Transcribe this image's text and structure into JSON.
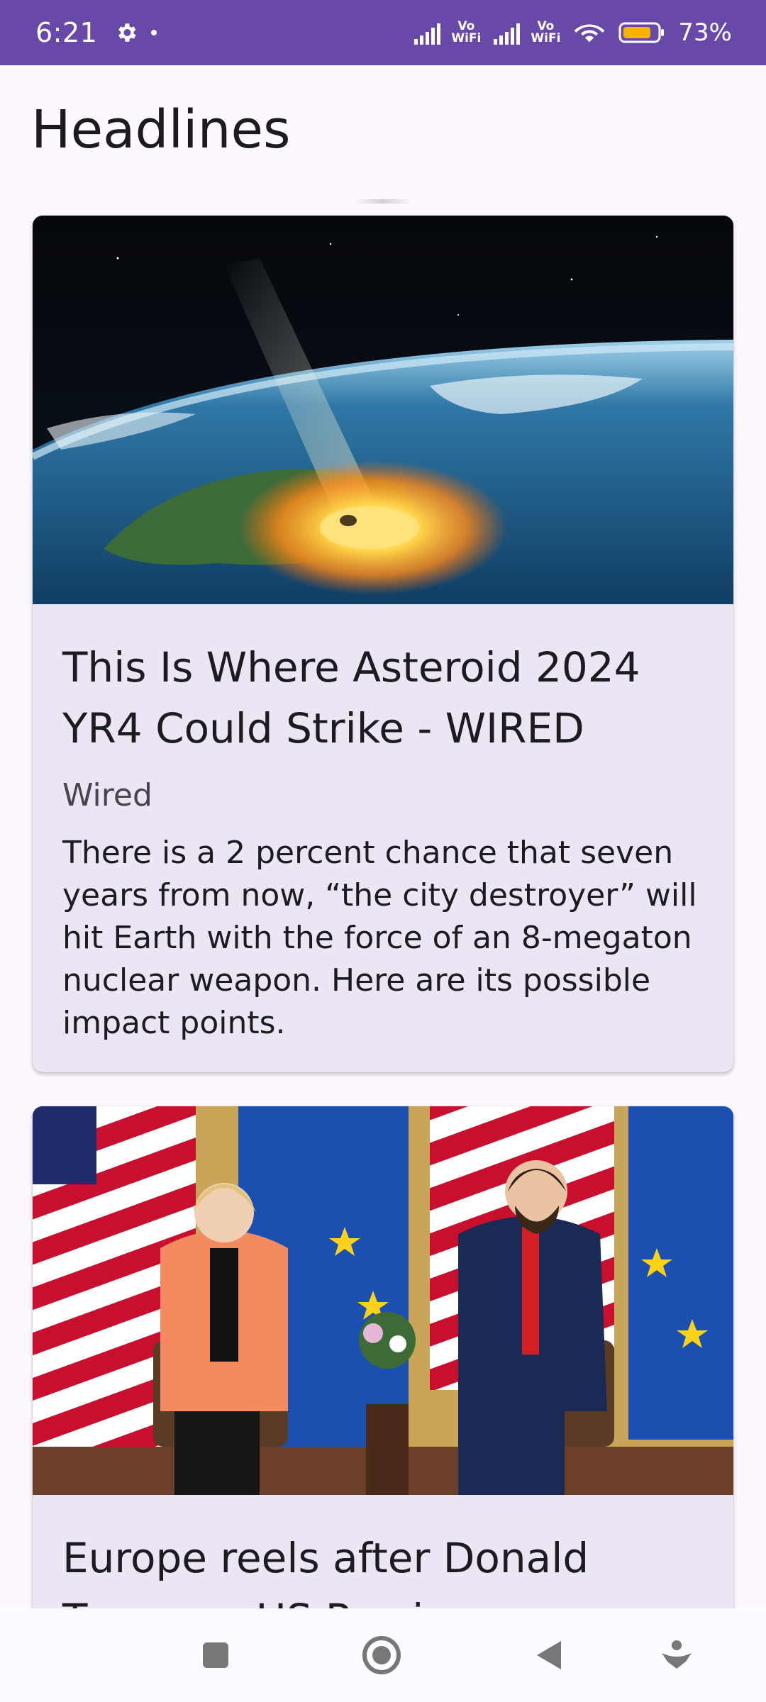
{
  "status_bar": {
    "time": "6:21",
    "battery_percent": "73%",
    "battery_level": 0.73,
    "vowifi_1": "Vo\nWiFi",
    "vowifi_2": "Vo\nWiFi",
    "accent": "#6949a8"
  },
  "page": {
    "title": "Headlines"
  },
  "articles": [
    {
      "headline": "This Is Where Asteroid 2024 YR4 Could Strike - WIRED",
      "source": "Wired",
      "description": "There is a 2 percent chance that seven years from now, “the city destroyer” will hit Earth with the force of an 8-megaton nuclear weapon. Here are its possible impact points.",
      "image_icon": "asteroid-impact-image"
    },
    {
      "headline": "Europe reels after Donald Trump ... US Presi",
      "image_icon": "eu-us-meeting-image"
    }
  ],
  "nav": {
    "recents_icon": "square-icon",
    "home_icon": "circle-icon",
    "back_icon": "triangle-back-icon",
    "assist_icon": "assistant-icon"
  }
}
